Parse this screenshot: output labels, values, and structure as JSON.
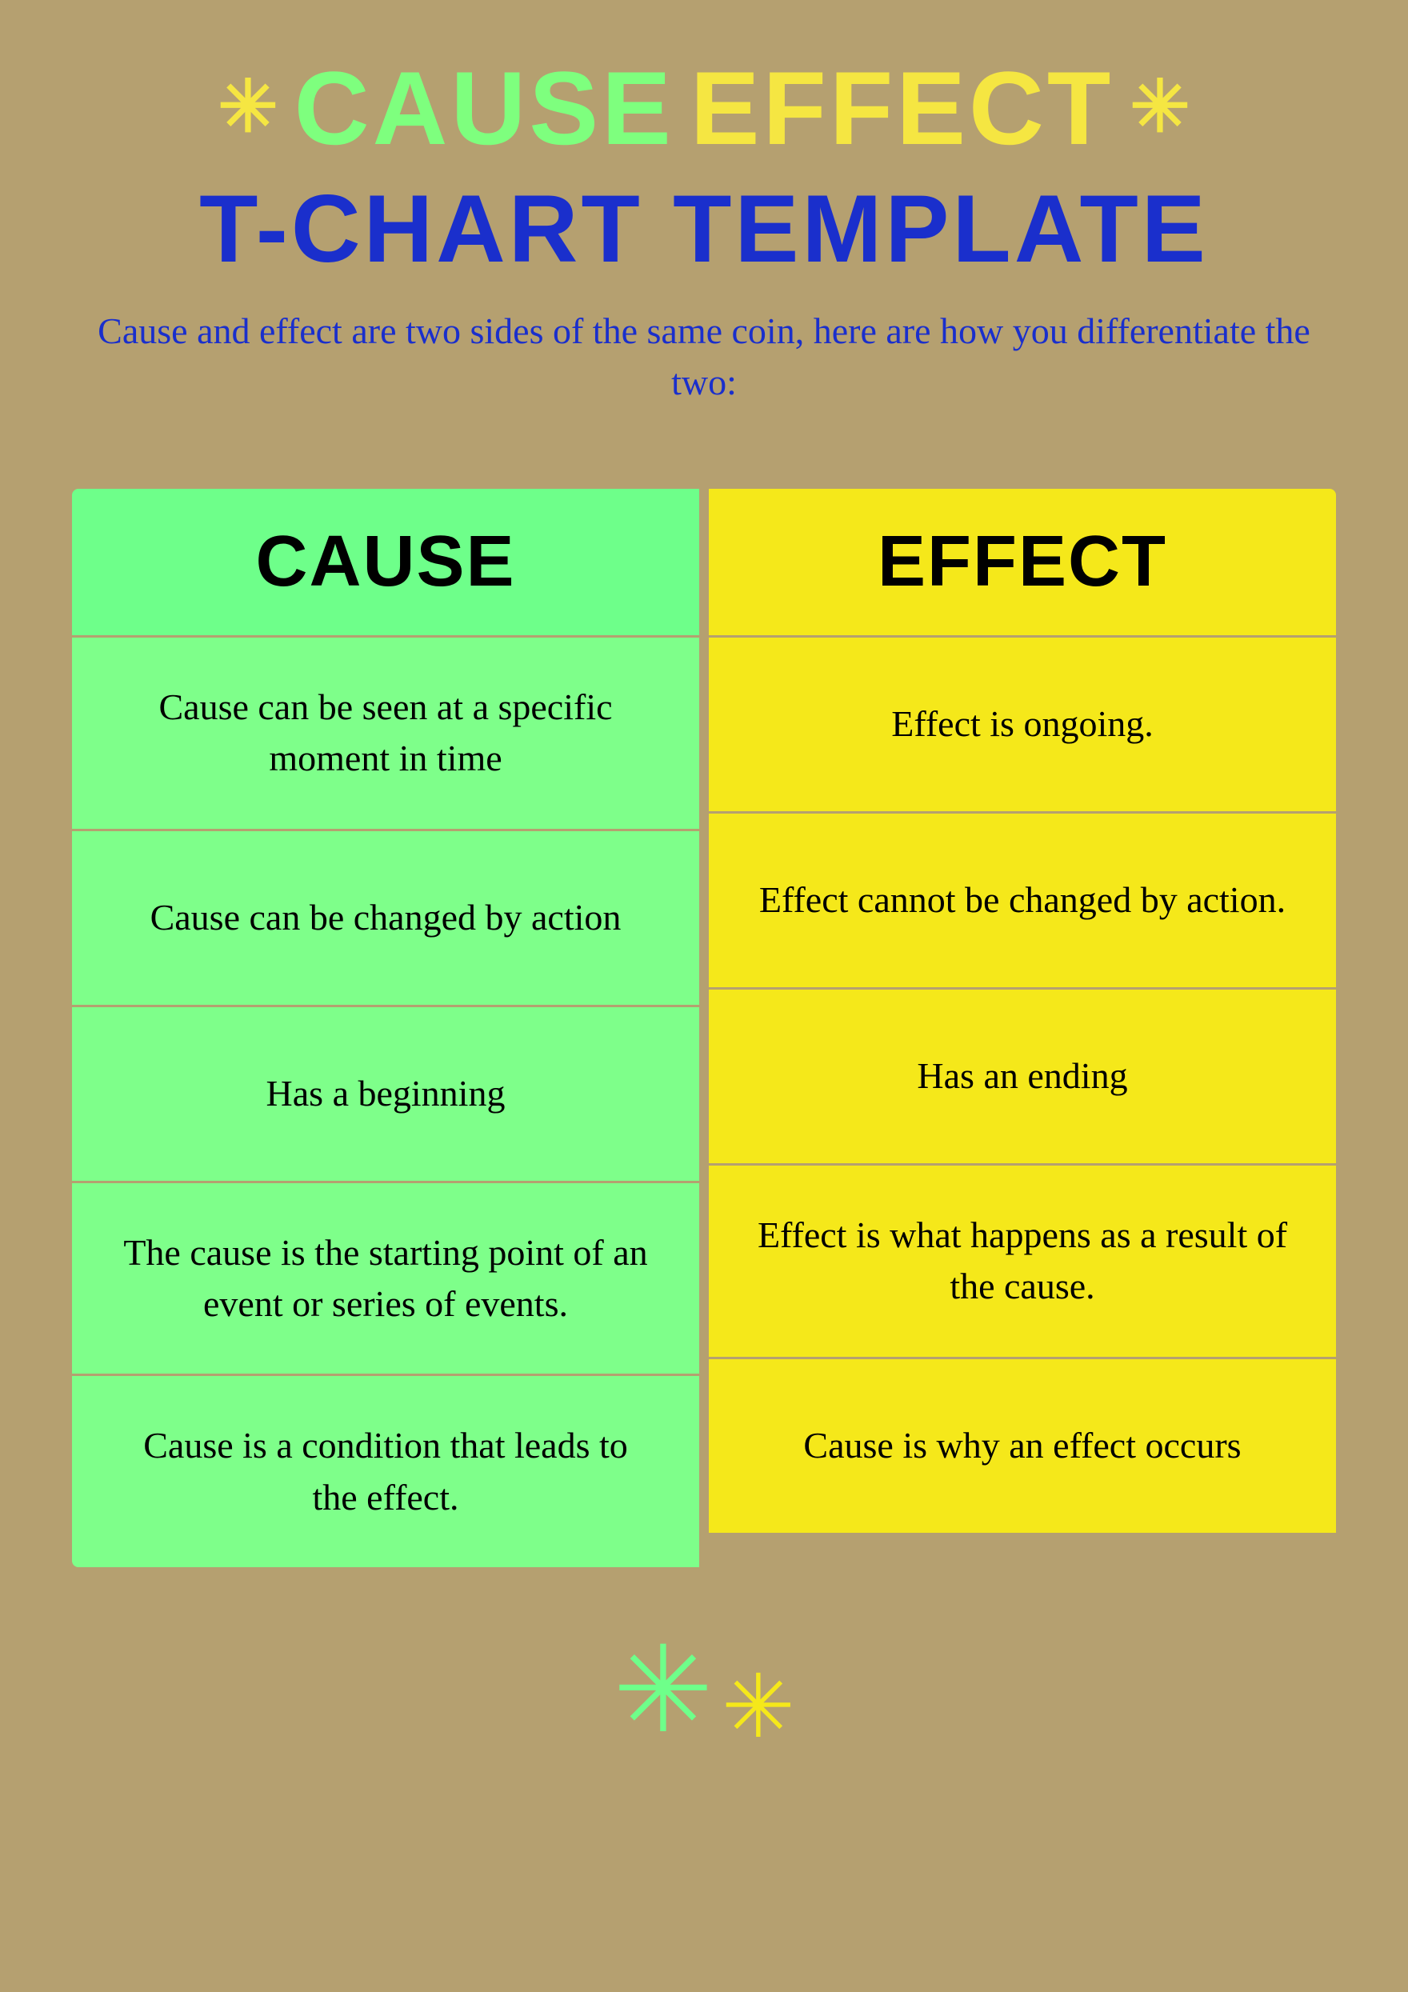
{
  "header": {
    "title_cause": "CAUSE",
    "title_effect": "EFFECT",
    "title_line2": "T-CHART TEMPLATE",
    "subtitle": "Cause and effect are two sides of the same coin,\nhere are how you differentiate the two:"
  },
  "table": {
    "cause_header": "CAUSE",
    "effect_header": "EFFECT",
    "rows": [
      {
        "cause": "Cause can be seen at a specific moment in time",
        "effect": "Effect is ongoing."
      },
      {
        "cause": "Cause can be changed by action",
        "effect": "Effect cannot be changed by action."
      },
      {
        "cause": "Has a beginning",
        "effect": "Has an ending"
      },
      {
        "cause": "The cause is the starting point of an event or series of events.",
        "effect": "Effect is what happens as a result of the cause."
      },
      {
        "cause": "Cause is a condition that leads to the effect.",
        "effect": "Cause is why an effect occurs"
      }
    ]
  },
  "decorations": {
    "star_symbol": "✳",
    "snowflake": "❋"
  }
}
